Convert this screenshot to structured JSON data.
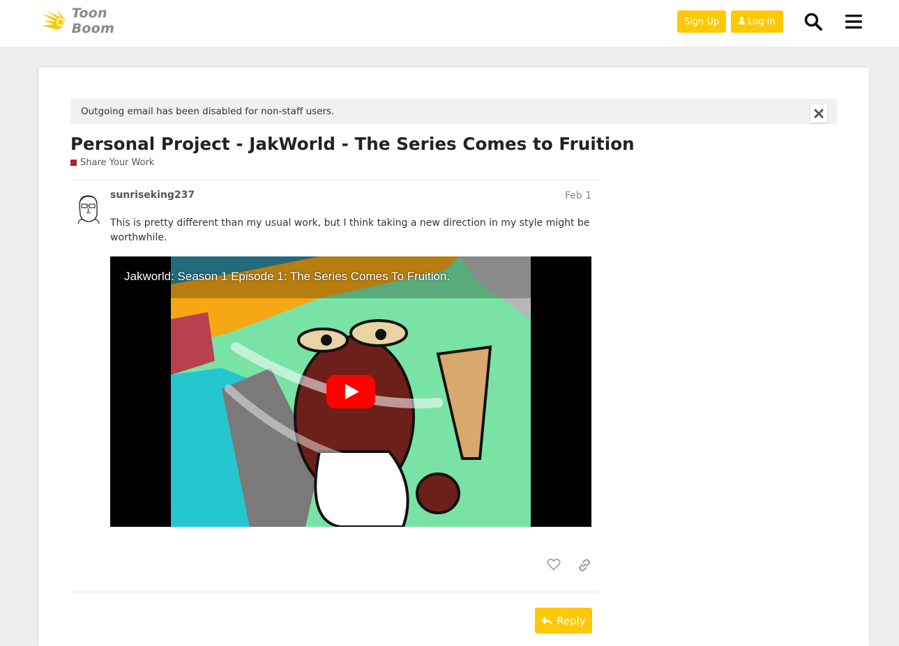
{
  "header": {
    "logo_text": "Toon Boom",
    "signup_label": "Sign Up",
    "login_label": "Log In",
    "accent_color": "#fdc907"
  },
  "banner": {
    "text": "Outgoing email has been disabled for non-staff users."
  },
  "topic": {
    "title": "Personal Project - JakWorld - The Series Comes to Fruition",
    "category": "Share Your Work",
    "category_color": "#b21f2d"
  },
  "post": {
    "username": "sunriseking237",
    "date": "Feb 1",
    "body": "This is pretty different than my usual work, but I think taking a new direction in my style might be worthwhile.",
    "video_title": "Jakworld: Season 1 Episode 1: The Series Comes To Fruition."
  },
  "actions": {
    "reply_label": "Reply"
  }
}
